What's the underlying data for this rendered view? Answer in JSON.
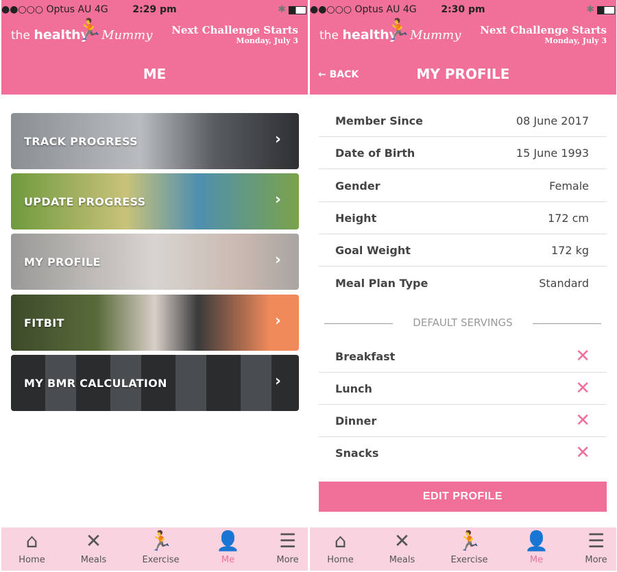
{
  "status_left": {
    "carrier": "●●○○○ Optus AU  4G",
    "time": "2:29 pm"
  },
  "status_right": {
    "carrier": "●●○○○ Optus AU  4G",
    "time": "2:30 pm"
  },
  "brand": {
    "the": "the",
    "healthy": "healthy",
    "mummy": "Mummy",
    "challenge": "Next Challenge Starts",
    "challenge_date": "Monday, July 3"
  },
  "colors": {
    "accent": "#f07099",
    "tabbar": "#fad3e0"
  },
  "left": {
    "title": "ME",
    "menu": [
      {
        "label": "TRACK PROGRESS"
      },
      {
        "label": "UPDATE PROGRESS"
      },
      {
        "label": "MY PROFILE"
      },
      {
        "label": "FITBIT"
      },
      {
        "label": "MY BMR CALCULATION"
      }
    ]
  },
  "right": {
    "back": "← BACK",
    "title": "MY PROFILE",
    "fields": [
      {
        "k": "Member Since",
        "v": "08 June 2017"
      },
      {
        "k": "Date of Birth",
        "v": "15 June 1993"
      },
      {
        "k": "Gender",
        "v": "Female"
      },
      {
        "k": "Height",
        "v": "172 cm"
      },
      {
        "k": "Goal Weight",
        "v": "172 kg"
      },
      {
        "k": "Meal Plan Type",
        "v": "Standard"
      }
    ],
    "servings_heading": "DEFAULT SERVINGS",
    "servings": [
      {
        "k": "Breakfast"
      },
      {
        "k": "Lunch"
      },
      {
        "k": "Dinner"
      },
      {
        "k": "Snacks"
      }
    ],
    "edit": "EDIT PROFILE"
  },
  "tabs": [
    {
      "label": "Home",
      "icon": "home-icon"
    },
    {
      "label": "Meals",
      "icon": "utensils-icon"
    },
    {
      "label": "Exercise",
      "icon": "running-icon"
    },
    {
      "label": "Me",
      "icon": "person-icon",
      "active": true
    },
    {
      "label": "More",
      "icon": "menu-icon"
    }
  ]
}
